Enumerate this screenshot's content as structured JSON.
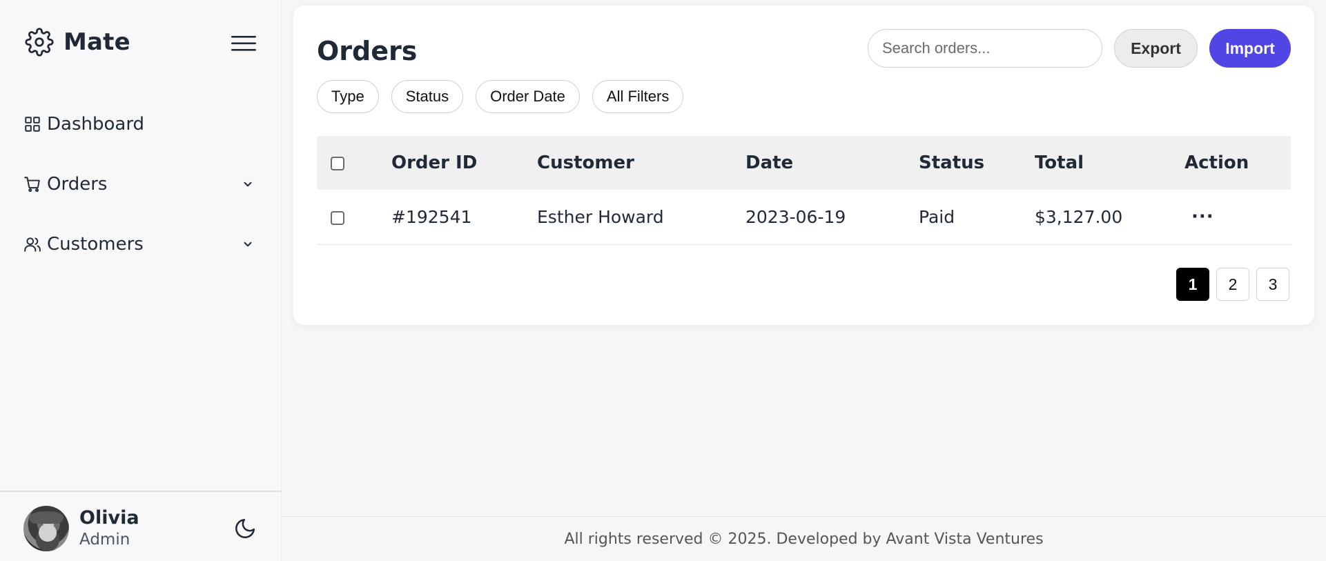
{
  "brand": {
    "name": "Mate",
    "icon": "gear-icon"
  },
  "sidebar": {
    "items": [
      {
        "label": "Dashboard",
        "icon": "grid-icon",
        "has_submenu": false
      },
      {
        "label": "Orders",
        "icon": "cart-icon",
        "has_submenu": true
      },
      {
        "label": "Customers",
        "icon": "users-icon",
        "has_submenu": true
      }
    ]
  },
  "user": {
    "name": "Olivia",
    "role": "Admin"
  },
  "main": {
    "title": "Orders",
    "search": {
      "placeholder": "Search orders...",
      "value": ""
    },
    "buttons": {
      "export_label": "Export",
      "import_label": "Import"
    },
    "filters": [
      "Type",
      "Status",
      "Order Date",
      "All Filters"
    ]
  },
  "table": {
    "headers": {
      "order_id": "Order ID",
      "customer": "Customer",
      "date": "Date",
      "status": "Status",
      "total": "Total",
      "action": "Action"
    },
    "rows": [
      {
        "order_id": "#192541",
        "customer": "Esther Howard",
        "date": "2023-06-19",
        "status": "Paid",
        "total": "$3,127.00",
        "action": "···"
      }
    ]
  },
  "pagination": {
    "pages": [
      "1",
      "2",
      "3"
    ],
    "current": "1"
  },
  "footer": {
    "text": "All rights reserved © 2025. Developed by Avant Vista Ventures"
  },
  "colors": {
    "accent": "#4f46e5",
    "paid": "#15803d",
    "text": "#1f2937"
  }
}
